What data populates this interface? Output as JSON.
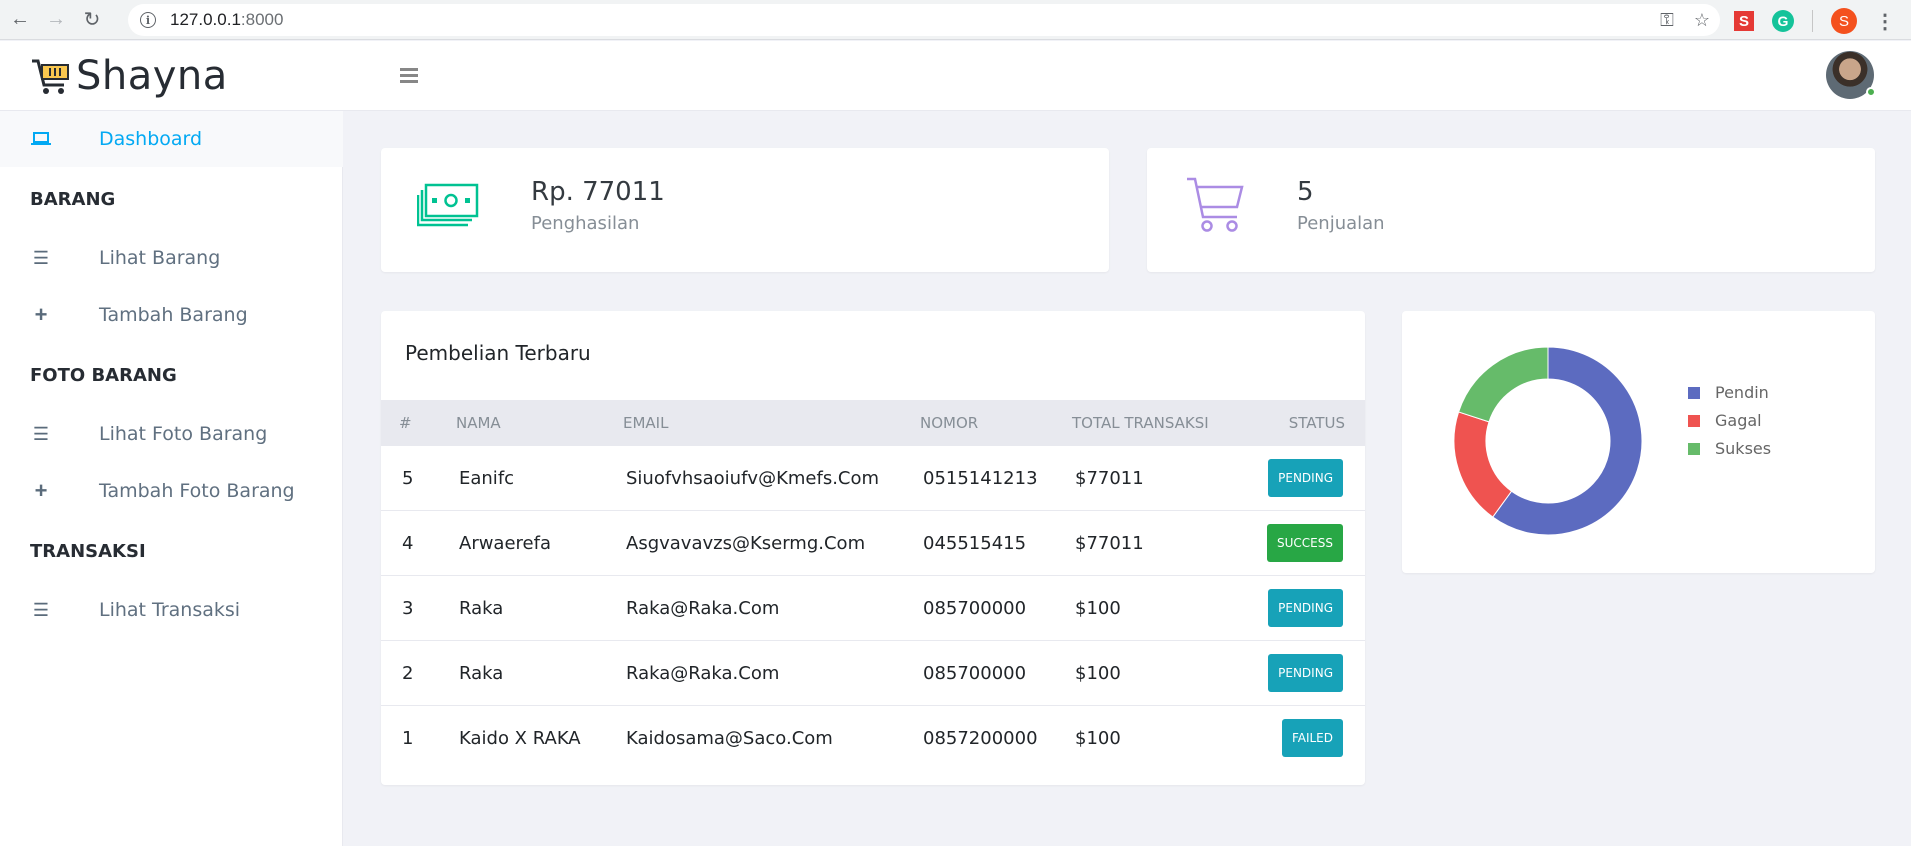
{
  "browser": {
    "url_host": "127.0.0.1",
    "url_port": ":8000",
    "extension_s_label": "S",
    "extension_g_label": "G",
    "profile_initial": "S"
  },
  "app": {
    "brand": "Shayna"
  },
  "sidebar": {
    "dashboard": "Dashboard",
    "section_barang": "BARANG",
    "lihat_barang": "Lihat Barang",
    "tambah_barang": "Tambah Barang",
    "section_foto": "FOTO BARANG",
    "lihat_foto": "Lihat Foto Barang",
    "tambah_foto": "Tambah Foto Barang",
    "section_transaksi": "TRANSAKSI",
    "lihat_transaksi": "Lihat Transaksi"
  },
  "stats": {
    "income_value": "Rp. 77011",
    "income_label": "Penghasilan",
    "sales_value": "5",
    "sales_label": "Penjualan"
  },
  "table": {
    "title": "Pembelian Terbaru",
    "headers": [
      "#",
      "NAMA",
      "EMAIL",
      "NOMOR",
      "TOTAL TRANSAKSI",
      "STATUS"
    ],
    "rows": [
      {
        "id": "5",
        "nama": "Eanifc",
        "email": "Siuofvhsaoiufv@Kmefs.Com",
        "nomor": "0515141213",
        "total": "$77011",
        "status": "PENDING"
      },
      {
        "id": "4",
        "nama": "Arwaerefa",
        "email": "Asgvavavzs@Ksermg.Com",
        "nomor": "045515415",
        "total": "$77011",
        "status": "SUCCESS"
      },
      {
        "id": "3",
        "nama": "Raka",
        "email": "Raka@Raka.Com",
        "nomor": "085700000",
        "total": "$100",
        "status": "PENDING"
      },
      {
        "id": "2",
        "nama": "Raka",
        "email": "Raka@Raka.Com",
        "nomor": "085700000",
        "total": "$100",
        "status": "PENDING"
      },
      {
        "id": "1",
        "nama": "Kaido X RAKA",
        "email": "Kaidosama@Saco.Com",
        "nomor": "0857200000",
        "total": "$100",
        "status": "FAILED"
      }
    ],
    "status_colors": {
      "PENDING": "#17a2b8",
      "SUCCESS": "#28a745",
      "FAILED": "#17a2b8"
    }
  },
  "chart_data": {
    "type": "pie",
    "labels": [
      "Pendin",
      "Gagal",
      "Sukses"
    ],
    "values": [
      3,
      1,
      1
    ],
    "colors": [
      "#5c6bc0",
      "#ef5350",
      "#66bb6a"
    ],
    "legend": "right",
    "style": "doughnut"
  },
  "colors": {
    "accent": "#03a9f3",
    "income_icon": "#00c292",
    "sales_icon": "#ab8ce4"
  },
  "icons": {
    "brand": "shopping-cart-icon",
    "dashboard": "laptop-icon",
    "list": "list-icon",
    "add": "plus-icon",
    "income": "money-icon",
    "sales": "cart-icon"
  }
}
